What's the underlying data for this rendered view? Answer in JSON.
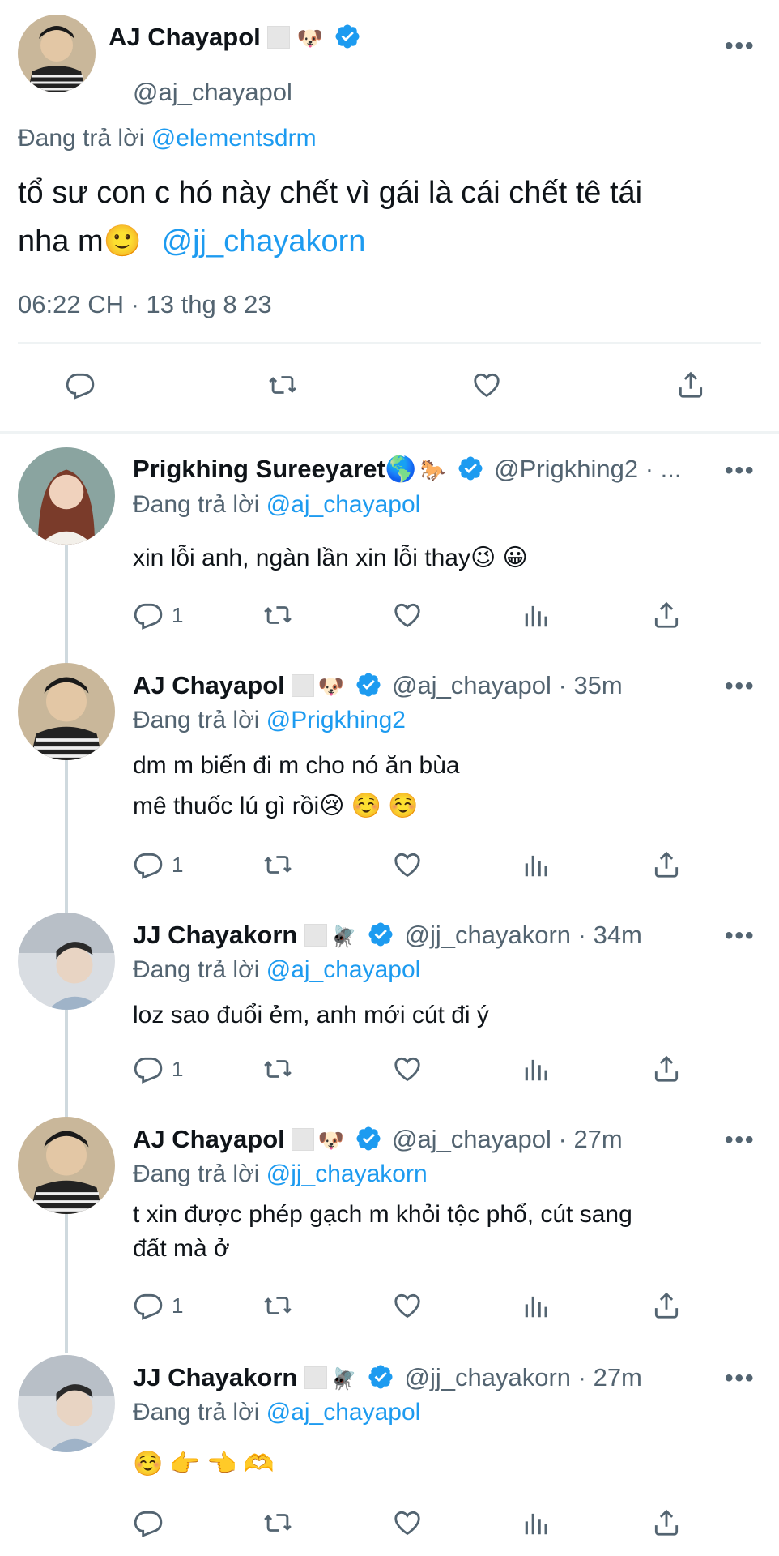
{
  "main_tweet": {
    "name": "AJ Chayapol",
    "emoji": "🐶",
    "handle": "@aj_chayapol",
    "replying_prefix": "Đang trả lời",
    "replying_to": "@elementsdrm",
    "text_line1": "tổ sư con c hó này chết vì gái là cái chết tê tái",
    "text_line2": "nha m🙂",
    "mention": "@jj_chayakorn",
    "timestamp": "06:22 CH · 13 thg 8 23"
  },
  "replies": [
    {
      "name": "Prigkhing Sureeyaret🌎",
      "emoji": "🐎",
      "handle_time": "@Prigkhing2 · ...",
      "replying_prefix": "Đang trả lời",
      "replying_to": "@aj_chayapol",
      "text": "xin lỗi anh, ngàn lần xin lỗi thay😉 😀",
      "reply_count": "1"
    },
    {
      "name": "AJ Chayapol",
      "emoji": "🐶",
      "handle_time": "@aj_chayapol · 35m",
      "replying_prefix": "Đang trả lời",
      "replying_to": "@Prigkhing2",
      "text_line1": "dm m biến đi m cho nó ăn bùa",
      "text_line2": "mê thuốc lú gì rồi😢 ☺️ ☺️",
      "reply_count": "1"
    },
    {
      "name": "JJ Chayakorn",
      "emoji": "🪰",
      "handle_time": "@jj_chayakorn · 34m",
      "replying_prefix": "Đang trả lời",
      "replying_to": "@aj_chayapol",
      "text": "loz sao đuổi ẻm, anh mới cút đi ý",
      "reply_count": "1"
    },
    {
      "name": "AJ Chayapol",
      "emoji": "🐶",
      "handle_time": "@aj_chayapol · 27m",
      "replying_prefix": "Đang trả lời",
      "replying_to": "@jj_chayakorn",
      "text_line1": "t xin được phép gạch m khỏi tộc phổ, cút sang",
      "text_line2": "đất mà ở",
      "reply_count": "1"
    },
    {
      "name": "JJ Chayakorn",
      "emoji": "🪰",
      "handle_time": "@jj_chayakorn · 27m",
      "replying_prefix": "Đang trả lời",
      "replying_to": "@aj_chayapol",
      "text": "☺️ 👉 👈 🫶",
      "reply_count": ""
    }
  ],
  "icons": {
    "reply": "reply-icon",
    "retweet": "retweet-icon",
    "like": "like-icon",
    "views": "views-icon",
    "share": "share-icon",
    "verified": "verified-icon",
    "more": "more-icon"
  },
  "colors": {
    "accent": "#1d9bf0",
    "text": "#0f1419",
    "muted": "#536471",
    "divider": "#eff3f4"
  },
  "more_label": "•••"
}
